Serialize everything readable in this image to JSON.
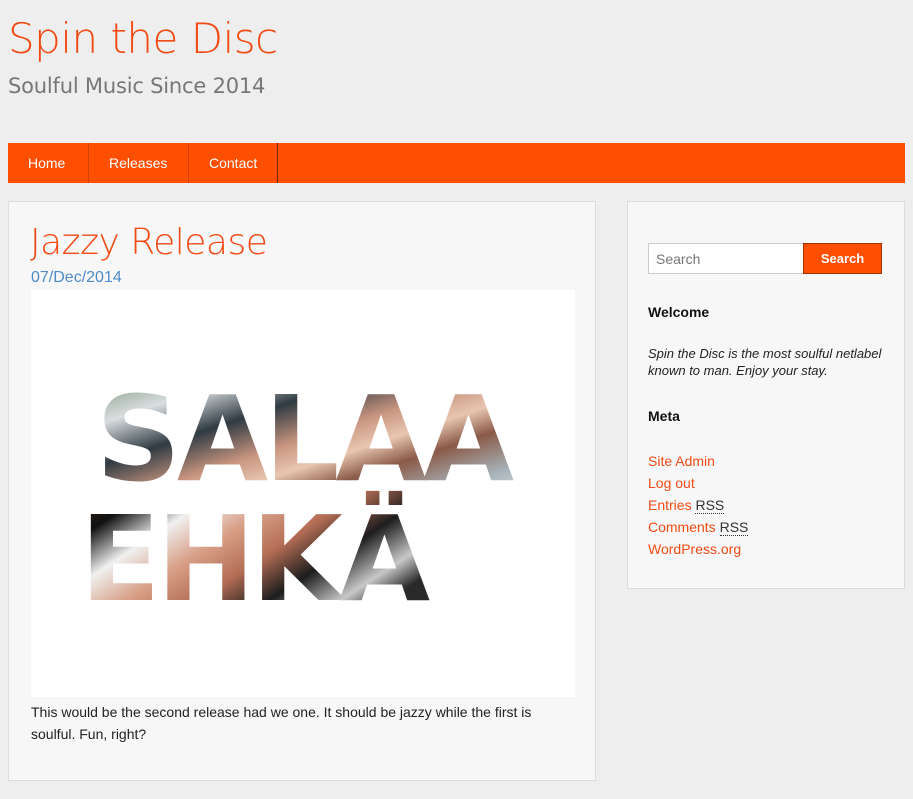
{
  "site": {
    "title": "Spin the Disc",
    "tagline": "Soulful Music Since 2014",
    "accent_color": "#fe4e00",
    "title_color": "#f24a14"
  },
  "nav": {
    "items": [
      {
        "label": "Home"
      },
      {
        "label": "Releases"
      },
      {
        "label": "Contact"
      }
    ]
  },
  "post": {
    "title": "Jazzy Release",
    "date": "07/Dec/2014",
    "image": {
      "line1": "SALAA",
      "line2": "EHKÄ"
    },
    "body": "This would be the second release had we one. It should be jazzy while the first is soulful. Fun, right?"
  },
  "sidebar": {
    "search": {
      "placeholder": "Search",
      "button_label": "Search"
    },
    "welcome": {
      "title": "Welcome",
      "text": "Spin the Disc is the most soulful netlabel known to man. Enjoy your stay."
    },
    "meta": {
      "title": "Meta",
      "site_admin": "Site Admin",
      "log_out": "Log out",
      "entries": "Entries",
      "comments": "Comments",
      "rss": "RSS",
      "wordpress": "WordPress.org"
    }
  }
}
